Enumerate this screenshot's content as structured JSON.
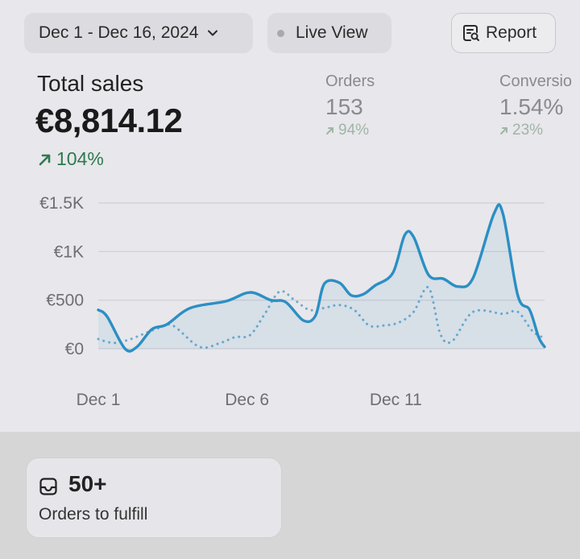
{
  "toolbar": {
    "date_range": "Dec 1 - Dec 16, 2024",
    "live_view": "Live View",
    "report": "Report"
  },
  "total_sales": {
    "title": "Total sales",
    "value": "€8,814.12",
    "change": "104%",
    "change_direction": "up",
    "change_color": "#2d7a4e"
  },
  "metrics": {
    "orders": {
      "label": "Orders",
      "value": "153",
      "change": "94%"
    },
    "conversion": {
      "label": "Conversio",
      "value": "1.54%",
      "change": "23%"
    }
  },
  "fulfill": {
    "count": "50+",
    "label": "Orders to fulfill"
  },
  "chart_data": {
    "type": "line",
    "y_ticks": [
      "€1.5K",
      "€1K",
      "€500",
      "€0"
    ],
    "y_tick_values": [
      1500,
      1000,
      500,
      0
    ],
    "x_tick_labels": [
      "Dec 1",
      "Dec 6",
      "Dec 11"
    ],
    "x_tick_days": [
      1,
      6,
      11
    ],
    "ylim": [
      0,
      1500
    ],
    "xlim": [
      1,
      16
    ],
    "series": [
      {
        "style": "solid",
        "color": "#2b8fc4",
        "fill": true,
        "x": [
          1,
          1.3,
          1.9,
          2.3,
          2.8,
          3.3,
          4.1,
          5.3,
          6.1,
          6.8,
          7.3,
          7.9,
          8.3,
          8.6,
          9.1,
          9.5,
          9.9,
          10.3,
          10.9,
          11.3,
          11.6,
          12.1,
          12.6,
          13.1,
          13.6,
          14.3,
          14.6,
          15.1,
          15.5,
          15.8,
          16
        ],
        "y": [
          400,
          330,
          0,
          20,
          200,
          250,
          420,
          490,
          580,
          500,
          480,
          290,
          340,
          670,
          680,
          550,
          560,
          650,
          780,
          1170,
          1150,
          760,
          720,
          640,
          730,
          1390,
          1390,
          550,
          400,
          120,
          20
        ]
      },
      {
        "style": "dotted",
        "color": "#4a9cc8",
        "fill": false,
        "x": [
          1,
          1.5,
          2,
          2.5,
          3,
          3.5,
          4.4,
          5.1,
          5.6,
          6.1,
          6.6,
          7.1,
          7.6,
          8.1,
          8.6,
          9.1,
          9.6,
          10.1,
          10.6,
          11.1,
          11.6,
          12.1,
          12.5,
          12.9,
          13.6,
          14.6,
          15.1,
          15.6,
          16
        ],
        "y": [
          100,
          60,
          90,
          150,
          210,
          240,
          20,
          60,
          120,
          140,
          360,
          590,
          500,
          400,
          420,
          450,
          400,
          240,
          240,
          270,
          380,
          630,
          150,
          80,
          380,
          360,
          380,
          180,
          110
        ]
      }
    ]
  }
}
